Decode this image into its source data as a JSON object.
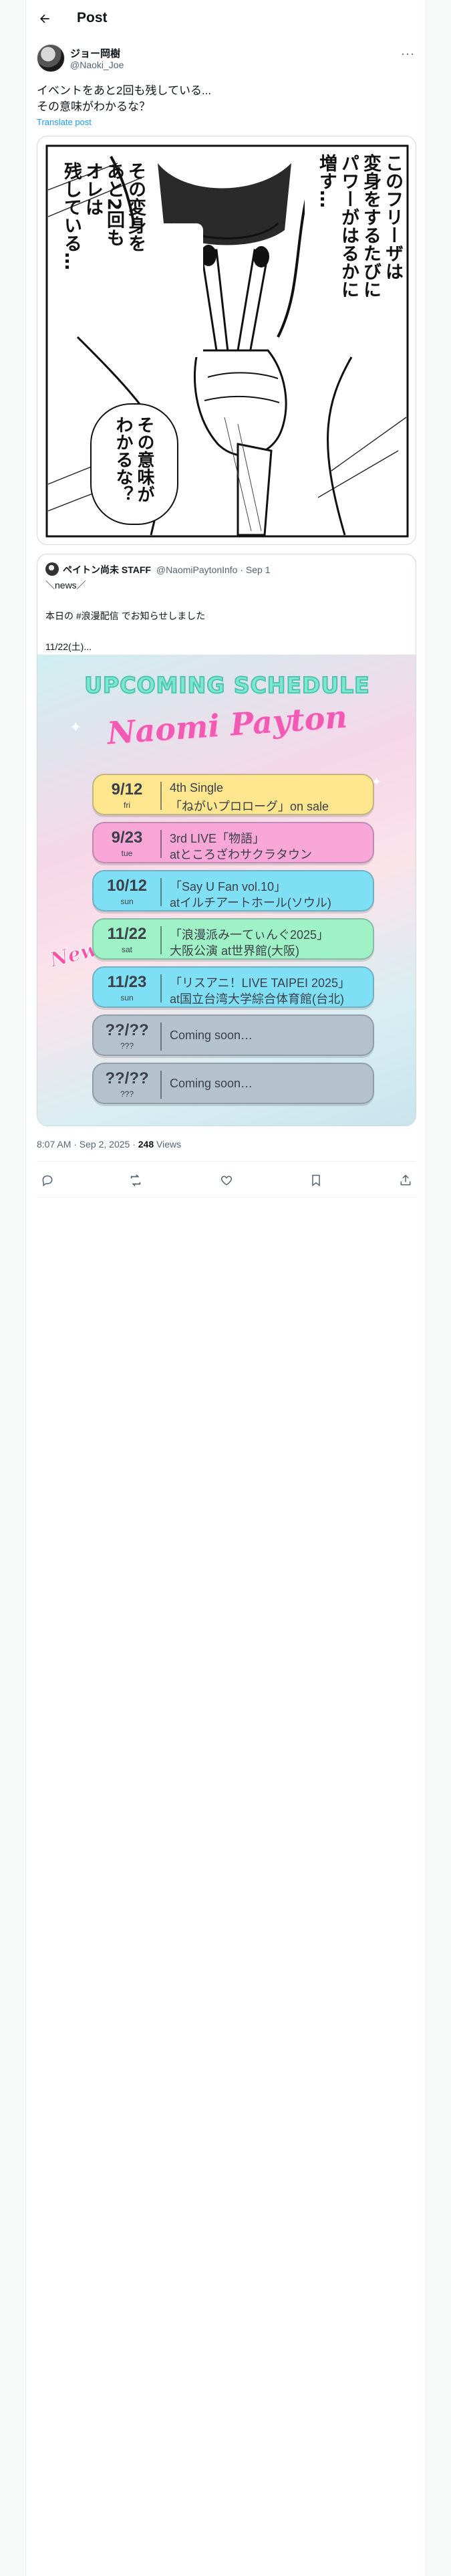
{
  "header": {
    "title": "Post"
  },
  "post": {
    "author_name": "ジョー岡樹",
    "author_handle": "@Naoki_Joe",
    "text_line1": "イベントをあと2回も残している...",
    "text_line2": "その意味がわかるな？",
    "translate_label": "Translate post",
    "image": {
      "caption_right": [
        "このフリーザは",
        "変身をするたびに",
        "パワーがはるかに",
        "増す…"
      ],
      "caption_mid": [
        "その変身を",
        "あと2回も",
        "オレは",
        "残している…"
      ],
      "caption_low": [
        "その意味が",
        "わかるな？"
      ]
    },
    "meta": {
      "time": "8:07 AM · Sep 2, 2025 · ",
      "views_count": "248",
      "views_label": " Views"
    }
  },
  "quote": {
    "author_name": "ペイトン尚未 STAFF",
    "author_handle_date": "@NaomiPaytonInfo · Sep 1",
    "line1": "＼news／",
    "line2": "本日の #浪漫配信 でお知らせしました",
    "line3": "11/22(土)...",
    "poster": {
      "title": "UPCOMING SCHEDULE",
      "signature": "Naomi Payton",
      "new_badge": "New!",
      "rows": [
        {
          "date": "9/12",
          "day": "fri",
          "line1": "4th Single",
          "line2": "「ねがいプロローグ」on sale",
          "color": "#fde68e"
        },
        {
          "date": "9/23",
          "day": "tue",
          "line1": "3rd LIVE「物語」",
          "line2": "atところざわサクラタウン",
          "color": "#f9a6d8"
        },
        {
          "date": "10/12",
          "day": "sun",
          "line1": "「Say U Fan vol.10」",
          "line2": "atイルチアートホール(ソウル)",
          "color": "#7fe0f5"
        },
        {
          "date": "11/22",
          "day": "sat",
          "line1": "「浪漫派み一てぃんぐ2025」",
          "line2": "大阪公演 at世界館(大阪)",
          "color": "#9ff2c6"
        },
        {
          "date": "11/23",
          "day": "sun",
          "line1": "「リスアニ！LIVE TAIPEI 2025」",
          "line2": "at国立台湾大学綜合体育館(台北)",
          "color": "#7fe0f5"
        },
        {
          "date": "??/??",
          "day": "???",
          "line1": "Coming soon…",
          "line2": "",
          "color": "#b4c2cc"
        },
        {
          "date": "??/??",
          "day": "???",
          "line1": "Coming soon…",
          "line2": "",
          "color": "#b4c2cc"
        }
      ]
    }
  },
  "actions": [
    "reply-icon",
    "repost-icon",
    "like-icon",
    "bookmark-icon",
    "share-icon"
  ]
}
